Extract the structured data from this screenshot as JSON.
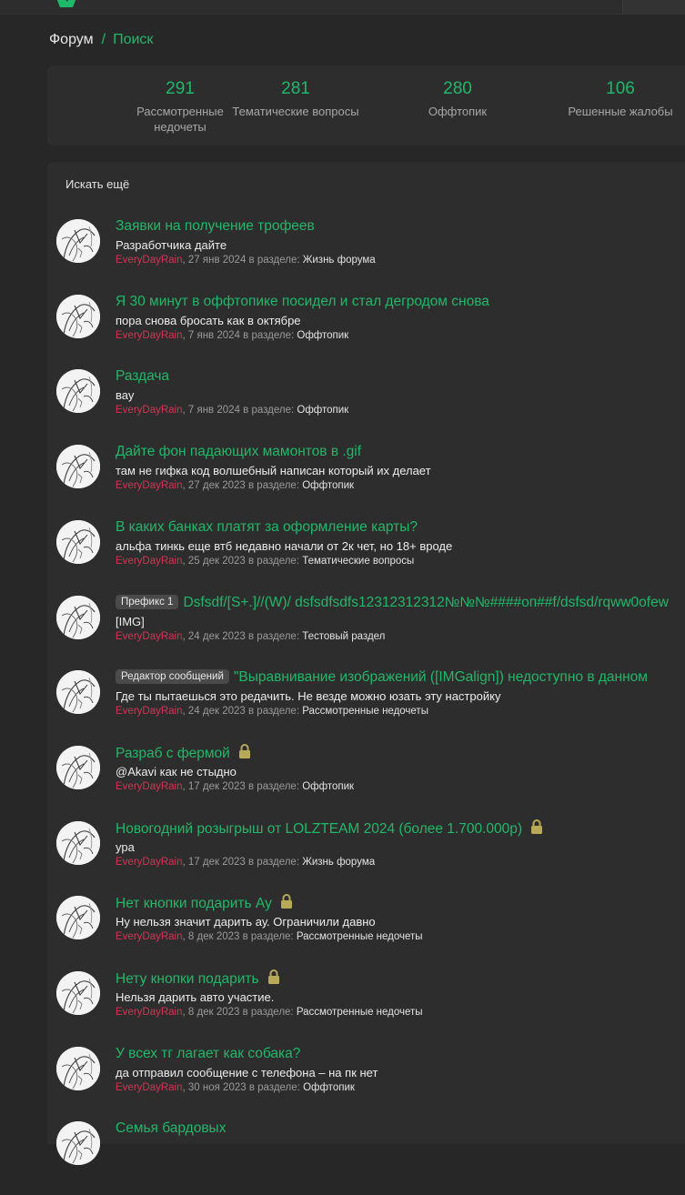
{
  "breadcrumb": {
    "home": "Форум",
    "separator": "/",
    "current": "Поиск"
  },
  "stats": [
    {
      "value": "291",
      "label": "Рассмотренные недочеты"
    },
    {
      "value": "281",
      "label": "Тематические вопросы"
    },
    {
      "value": "280",
      "label": "Оффтопик"
    },
    {
      "value": "106",
      "label": "Решенные жалобы"
    }
  ],
  "search_more": "Искать ещё",
  "in_section": "в разделе:",
  "colors": {
    "accent": "#1fb86a",
    "author": "#d43355",
    "lock": "#b8a958",
    "panel": "#2d2d2d",
    "background": "#272727"
  },
  "results": [
    {
      "title": "Заявки на получение трофеев",
      "prefix": "",
      "locked": false,
      "snippet": "Разработчика дайте",
      "author": "EveryDayRain",
      "date": "27 янв 2024",
      "forum": "Жизнь форума"
    },
    {
      "title": "Я 30 минут в оффтопике посидел и стал дегродом снова",
      "prefix": "",
      "locked": false,
      "snippet": "пора снова бросать как в октябре",
      "author": "EveryDayRain",
      "date": "7 янв 2024",
      "forum": "Оффтопик"
    },
    {
      "title": "Раздача",
      "prefix": "",
      "locked": false,
      "snippet": "вау",
      "author": "EveryDayRain",
      "date": "7 янв 2024",
      "forum": "Оффтопик"
    },
    {
      "title": "Дайте фон падающих мамонтов в .gif",
      "prefix": "",
      "locked": false,
      "snippet": "там не гифка код волшебный написан который их делает",
      "author": "EveryDayRain",
      "date": "27 дек 2023",
      "forum": "Оффтопик"
    },
    {
      "title": "В каких банках платят за оформление карты?",
      "prefix": "",
      "locked": false,
      "snippet": "альфа тинкь еще втб недавно начали от 2к чет, но 18+ вроде",
      "author": "EveryDayRain",
      "date": "25 дек 2023",
      "forum": "Тематические вопросы"
    },
    {
      "title": "Dsfsdf/[S+.]//(W)/ dsfsdfsdfs12312312312№№№####оп##f/dsfsd/rqww0ofew",
      "prefix": "Префикс 1",
      "locked": false,
      "snippet": "[IMG]",
      "author": "EveryDayRain",
      "date": "24 дек 2023",
      "forum": "Тестовый раздел"
    },
    {
      "title": "\"Выравнивание изображений ([IMGalign]) недоступно в данном",
      "prefix": "Редактор сообщений",
      "locked": false,
      "snippet": "Где ты пытаешься это редачить. Не везде можно юзать эту настройку",
      "author": "EveryDayRain",
      "date": "24 дек 2023",
      "forum": "Рассмотренные недочеты"
    },
    {
      "title": "Разраб с фермой",
      "prefix": "",
      "locked": true,
      "snippet": "@Akavi как не стыдно",
      "author": "EveryDayRain",
      "date": "17 дек 2023",
      "forum": "Оффтопик"
    },
    {
      "title": "Новогодний розыгрыш от LOLZTEAM 2024 (более 1.700.000р)",
      "prefix": "",
      "locked": true,
      "snippet": "ура",
      "author": "EveryDayRain",
      "date": "17 дек 2023",
      "forum": "Жизнь форума"
    },
    {
      "title": "Нет кнопки подарить Ау",
      "prefix": "",
      "locked": true,
      "snippet": "Ну нельзя значит дарить ау. Ограничили давно",
      "author": "EveryDayRain",
      "date": "8 дек 2023",
      "forum": "Рассмотренные недочеты"
    },
    {
      "title": "Нету кнопки подарить",
      "prefix": "",
      "locked": true,
      "snippet": "Нельзя дарить авто участие.",
      "author": "EveryDayRain",
      "date": "8 дек 2023",
      "forum": "Рассмотренные недочеты"
    },
    {
      "title": "У всех тг лагает как собака?",
      "prefix": "",
      "locked": false,
      "snippet": "да отправил сообщение с телефона – на пк нет",
      "author": "EveryDayRain",
      "date": "30 ноя 2023",
      "forum": "Оффтопик"
    },
    {
      "title": "Семья бардовых",
      "prefix": "",
      "locked": false,
      "snippet": "",
      "author": "",
      "date": "",
      "forum": ""
    }
  ]
}
